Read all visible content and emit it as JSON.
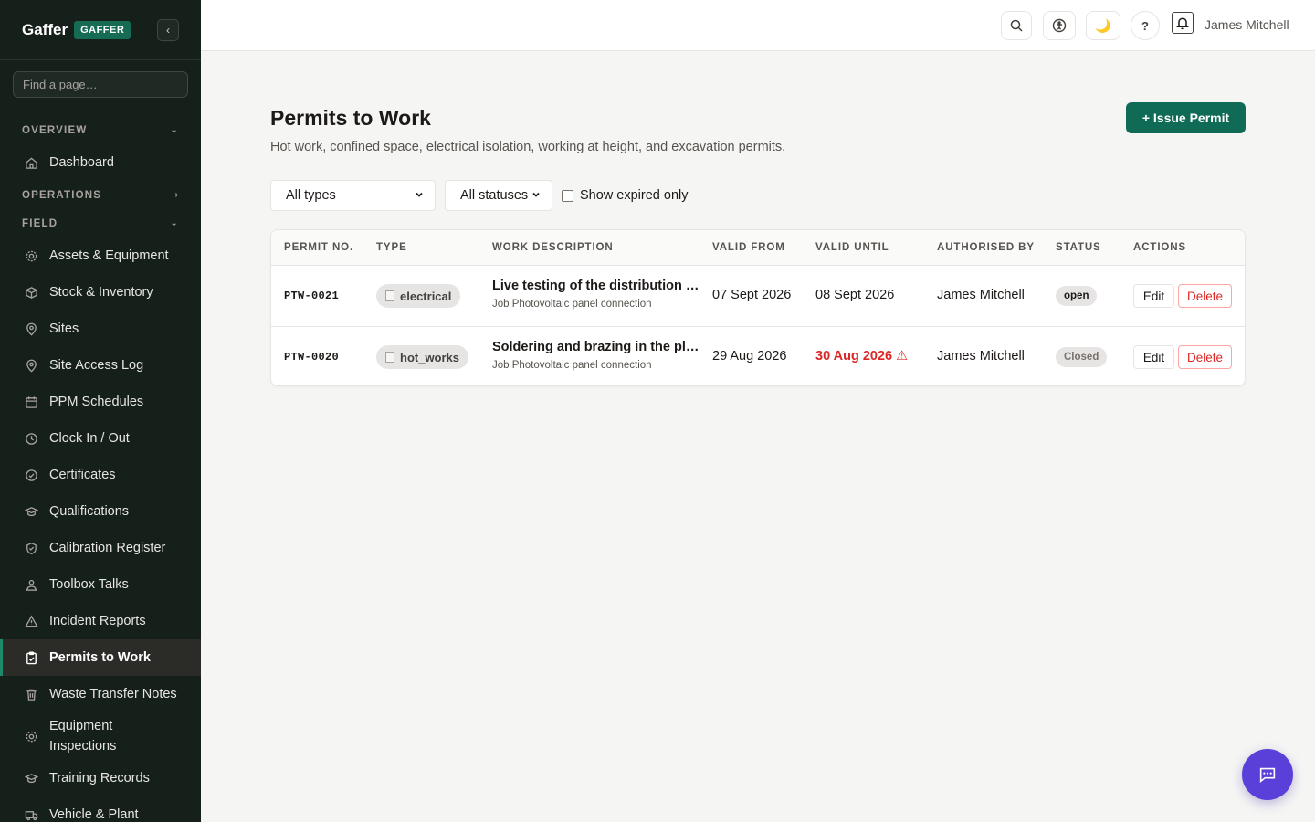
{
  "brand": {
    "name": "Gaffer",
    "badge": "GAFFER",
    "collapse": "‹"
  },
  "search": {
    "placeholder": "Find a page…"
  },
  "sidebar": {
    "sections": [
      {
        "label": "OVERVIEW",
        "chevron": "⌄"
      },
      {
        "label": "OPERATIONS",
        "chevron": "›"
      },
      {
        "label": "FIELD",
        "chevron": "⌄"
      }
    ],
    "overview_items": [
      {
        "label": "Dashboard",
        "icon": "home-icon"
      }
    ],
    "field_items": [
      {
        "label": "Assets & Equipment",
        "icon": "gear-icon"
      },
      {
        "label": "Stock & Inventory",
        "icon": "box-icon"
      },
      {
        "label": "Sites",
        "icon": "pin-icon"
      },
      {
        "label": "Site Access Log",
        "icon": "pin-icon"
      },
      {
        "label": "PPM Schedules",
        "icon": "calendar-icon"
      },
      {
        "label": "Clock In / Out",
        "icon": "clock-icon"
      },
      {
        "label": "Certificates",
        "icon": "check-circle-icon"
      },
      {
        "label": "Qualifications",
        "icon": "graduation-icon"
      },
      {
        "label": "Calibration Register",
        "icon": "shield-icon"
      },
      {
        "label": "Toolbox Talks",
        "icon": "people-icon"
      },
      {
        "label": "Incident Reports",
        "icon": "warning-icon"
      },
      {
        "label": "Permits to Work",
        "icon": "clipboard-icon",
        "active": true
      },
      {
        "label": "Waste Transfer Notes",
        "icon": "trash-icon"
      },
      {
        "label": "Equipment Inspections",
        "icon": "gear-icon"
      },
      {
        "label": "Training Records",
        "icon": "graduation-icon"
      },
      {
        "label": "Vehicle & Plant",
        "icon": "truck-icon"
      }
    ]
  },
  "topbar": {
    "user": "James Mitchell",
    "theme_glyph": "🌙",
    "help_glyph": "?"
  },
  "page": {
    "title": "Permits to Work",
    "subtitle": "Hot work, confined space, electrical isolation, working at height, and excavation permits.",
    "issue_button": "+ Issue Permit"
  },
  "filters": {
    "type": "All types",
    "status": "All statuses",
    "expired_label": "Show expired only",
    "expired_checked": false
  },
  "table": {
    "headers": [
      "PERMIT NO.",
      "TYPE",
      "WORK DESCRIPTION",
      "VALID FROM",
      "VALID UNTIL",
      "AUTHORISED BY",
      "STATUS",
      "ACTIONS"
    ],
    "rows": [
      {
        "permit_no": "PTW-0021",
        "type": "electrical",
        "title": "Live testing of the distribution …",
        "job": "Job Photovoltaic panel connection",
        "valid_from": "07 Sept 2026",
        "valid_until": "08 Sept 2026",
        "authorised_by": "James Mitchell",
        "status": "open",
        "edit": "Edit",
        "delete": "Delete"
      },
      {
        "permit_no": "PTW-0020",
        "type": "hot_works",
        "title": "Soldering and brazing in the pl…",
        "job": "Job Photovoltaic panel connection",
        "valid_from": "29 Aug 2026",
        "valid_until": "30 Aug 2026 ⚠",
        "authorised_by": "James Mitchell",
        "status": "Closed",
        "edit": "Edit",
        "delete": "Delete"
      }
    ]
  },
  "colors": {
    "accent": "#0f6b55",
    "sidebar_bg": "#15201b",
    "danger": "#dc2626",
    "fab": "#5b3fd9"
  }
}
